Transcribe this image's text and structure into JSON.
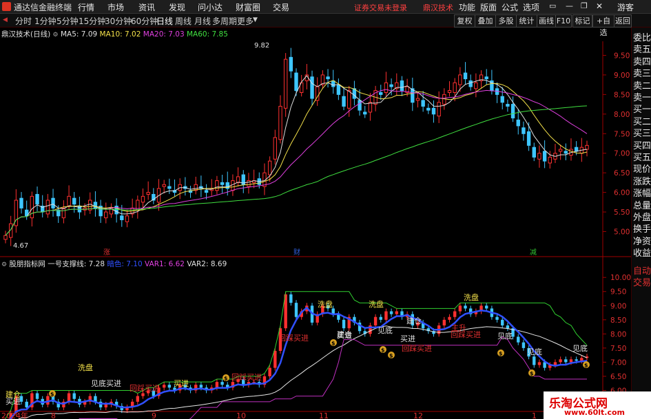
{
  "window": {
    "app_title": "通达信金融终端",
    "menu": [
      "行情",
      "市场",
      "资讯",
      "发现",
      "问小达",
      "财富圈",
      "交易"
    ],
    "warning": "证券交易未登录",
    "account_label": "鼎汉技术",
    "right_menu": [
      "功能",
      "版面",
      "公式",
      "选项"
    ],
    "guest": "游客"
  },
  "toolbar": {
    "periods": [
      "分时",
      "1分钟",
      "5分钟",
      "15分钟",
      "30分钟",
      "60分钟",
      "日线",
      "周线",
      "月线",
      "多周期",
      "更多"
    ],
    "active_period": "日线",
    "right_buttons": [
      "复权",
      "叠加",
      "多股",
      "统计",
      "画线",
      "F10",
      "标记",
      "+自选",
      "返回"
    ]
  },
  "side_panel": {
    "items": [
      "委比",
      "卖五",
      "卖四",
      "卖三",
      "卖二",
      "卖一",
      "买一",
      "买二",
      "买三",
      "买四",
      "买五",
      "现价",
      "涨跌",
      "涨幅",
      "总量",
      "外盘",
      "换手",
      "净资",
      "收益"
    ],
    "bottom_items": [
      "自动",
      "交易"
    ]
  },
  "main_chart": {
    "stock_label": "鼎汉技术(日线)",
    "ma_legend": [
      {
        "name": "MA5",
        "value": "7.09",
        "color": "#e0e0e0"
      },
      {
        "name": "MA10",
        "value": "7.02",
        "color": "#f4e14a"
      },
      {
        "name": "MA20",
        "value": "7.03",
        "color": "#e040e0"
      },
      {
        "name": "MA60",
        "value": "7.85",
        "color": "#40e040"
      }
    ],
    "high_label": "9.82",
    "low_label": "4.67",
    "markers": [
      {
        "text": "涨",
        "color": "#e03030"
      },
      {
        "text": "财",
        "color": "#3060e0"
      },
      {
        "text": "减",
        "color": "#30c030"
      }
    ]
  },
  "sub_chart": {
    "indicator_name": "股朋指标网",
    "legend": [
      {
        "name": "一号支撑线",
        "value": "7.28",
        "color": "#e0e0e0"
      },
      {
        "name": "暗色",
        "value": "7.10",
        "color": "#3050ff"
      },
      {
        "name": "VAR1",
        "value": "6.62",
        "color": "#e040e0"
      },
      {
        "name": "VAR2",
        "value": "8.69",
        "color": "#e0e0e0"
      }
    ],
    "signals": {
      "wash": "洗盘",
      "buy": "买进",
      "bottom": "见底",
      "bottom_buy": "见底买进",
      "pullback_buy": "回踩买进",
      "build": "建仓",
      "rise": "主升",
      "money": "$"
    }
  },
  "time_axis": [
    "2024年",
    "8",
    "9",
    "10",
    "11",
    "12",
    "1"
  ],
  "chart_data": [
    {
      "type": "candlestick",
      "title": "鼎汉技术(日线)",
      "ylim": [
        4.5,
        10.0
      ],
      "yticks": [
        "9.50",
        "9.00",
        "8.50",
        "8.00",
        "7.50",
        "7.00",
        "6.50",
        "6.00",
        "5.50",
        "5.00"
      ],
      "close": [
        4.9,
        5.2,
        5.8,
        5.6,
        5.4,
        5.9,
        5.7,
        5.5,
        5.8,
        5.6,
        5.4,
        5.6,
        5.9,
        5.7,
        5.5,
        5.6,
        5.8,
        5.6,
        5.4,
        5.5,
        5.6,
        5.45,
        5.3,
        5.4,
        5.6,
        5.8,
        5.9,
        6.0,
        5.8,
        6.1,
        6.2,
        6.1,
        6.0,
        6.2,
        6.1,
        6.0,
        6.2,
        6.1,
        6.0,
        6.1,
        6.3,
        6.2,
        6.1,
        6.3,
        6.4,
        6.2,
        6.3,
        6.3,
        6.2,
        6.5,
        6.8,
        7.4,
        8.2,
        9.4,
        9.1,
        8.6,
        8.8,
        9.0,
        8.4,
        8.7,
        9.0,
        8.9,
        8.7,
        8.5,
        8.2,
        8.6,
        8.4,
        8.1,
        8.0,
        8.3,
        8.6,
        8.5,
        8.8,
        8.7,
        8.8,
        8.6,
        8.7,
        8.3,
        8.4,
        8.2,
        8.1,
        8.0,
        8.3,
        8.5,
        8.6,
        8.8,
        9.0,
        8.9,
        8.7,
        8.8,
        9.0,
        8.9,
        8.6,
        8.5,
        8.3,
        8.2,
        7.9,
        7.7,
        7.5,
        7.2,
        6.9,
        7.0,
        6.8,
        6.9,
        7.0,
        7.1,
        7.0,
        7.1,
        7.05,
        7.15,
        7.2
      ],
      "ma60_last": 7.85
    },
    {
      "type": "line",
      "title": "股朋指标网",
      "ylim": [
        5.5,
        10.2
      ],
      "yticks": [
        "10.00",
        "9.50",
        "9.00",
        "8.50",
        "8.00",
        "7.50",
        "7.00",
        "6.50",
        "6.00"
      ],
      "series": [
        {
          "name": "一号支撑线",
          "last": 7.28
        },
        {
          "name": "VAR1",
          "last": 6.62
        },
        {
          "name": "VAR2",
          "last": 8.69
        }
      ]
    }
  ]
}
